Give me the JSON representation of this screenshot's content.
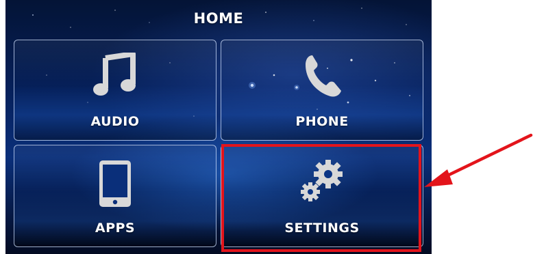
{
  "header": {
    "title": "HOME"
  },
  "tiles": [
    {
      "label": "AUDIO",
      "icon": "music-note-icon"
    },
    {
      "label": "PHONE",
      "icon": "phone-handset-icon"
    },
    {
      "label": "APPS",
      "icon": "tablet-icon"
    },
    {
      "label": "SETTINGS",
      "icon": "gears-icon"
    }
  ],
  "annotation": {
    "highlight_color": "#e3141b",
    "arrow_color": "#e3141b",
    "target": "SETTINGS"
  },
  "colors": {
    "background_dark": "#041436",
    "background_mid": "#0a2f7a",
    "tile_border": "#d2e1ff",
    "icon_fill": "#d8d8d8",
    "text": "#ffffff"
  }
}
